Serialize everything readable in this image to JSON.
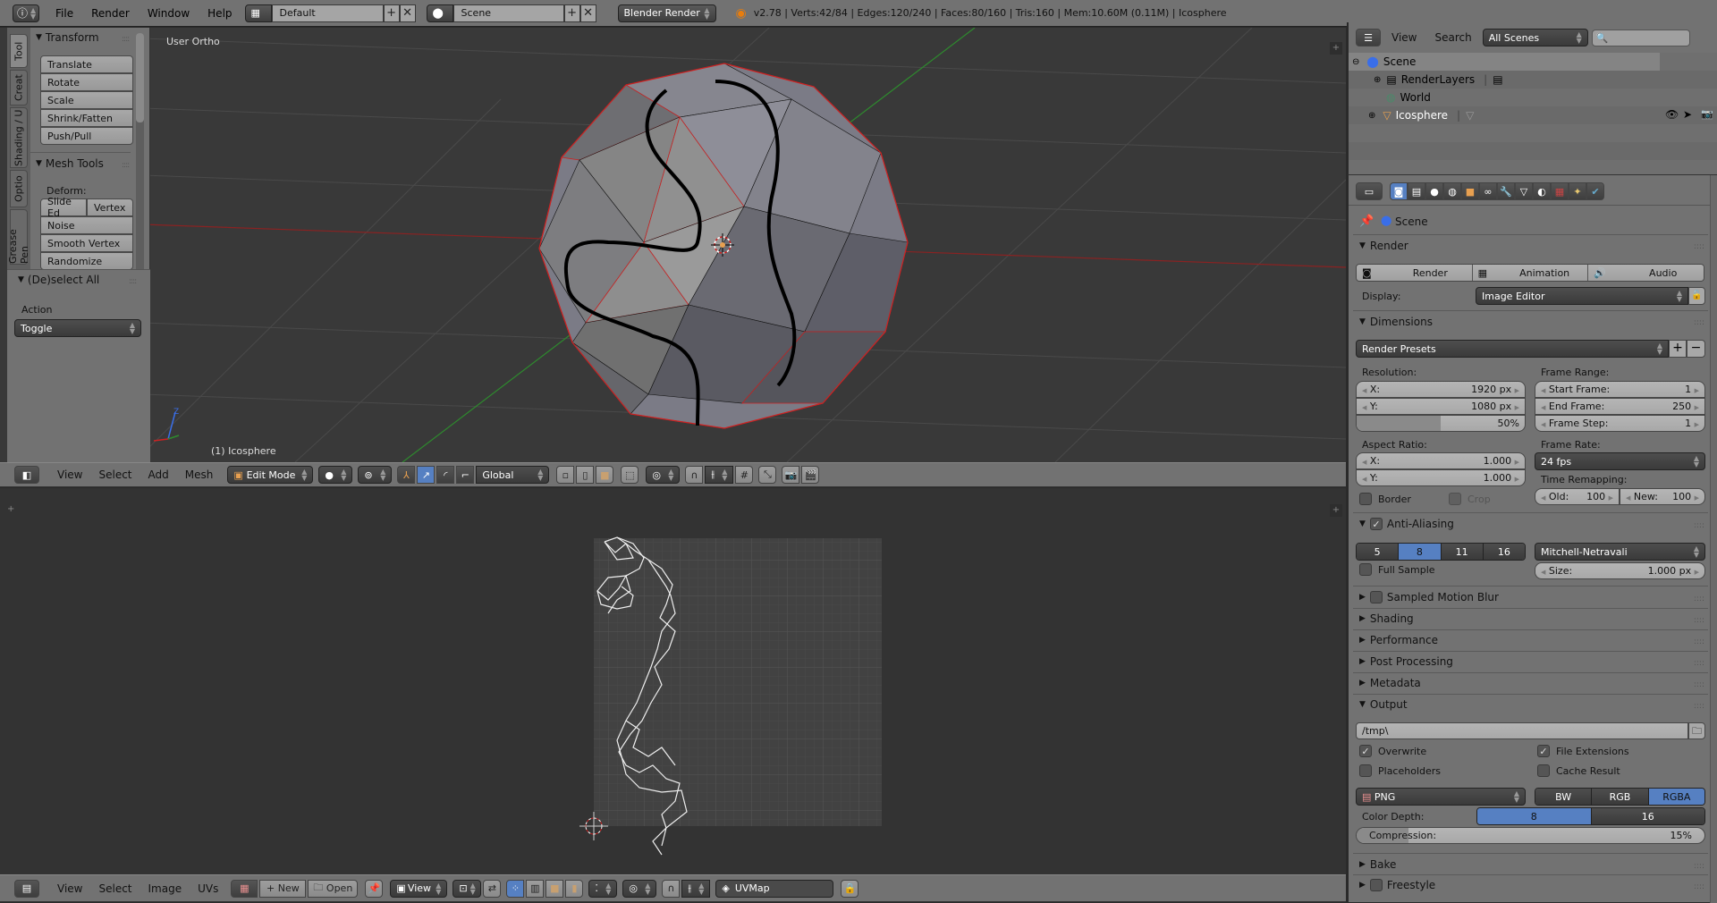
{
  "topbar": {
    "menus": [
      "File",
      "Render",
      "Window",
      "Help"
    ],
    "layout": "Default",
    "scene": "Scene",
    "engine": "Blender Render",
    "stats": "v2.78 | Verts:42/84 | Edges:120/240 | Faces:80/160 | Tris:160 | Mem:10.60M (0.11M) | Icosphere"
  },
  "toolshelf": {
    "tabs": [
      "Tool",
      "Creat",
      "Shading / U",
      "Optio",
      "Grease Pen"
    ],
    "transform_title": "Transform",
    "transform_buttons": [
      "Translate",
      "Rotate",
      "Scale",
      "Shrink/Fatten",
      "Push/Pull"
    ],
    "mesh_tools_title": "Mesh Tools",
    "deform_label": "Deform:",
    "deform_row": [
      "Slide Ed",
      "Vertex"
    ],
    "deform_buttons": [
      "Noise",
      "Smooth Vertex",
      "Randomize"
    ],
    "operator_title": "(De)select All",
    "action_label": "Action",
    "action_value": "Toggle"
  },
  "viewport": {
    "view_label": "User Ortho",
    "object_label": "(1) Icosphere",
    "axis_z": "Z"
  },
  "view3d_header": {
    "menus": [
      "View",
      "Select",
      "Add",
      "Mesh"
    ],
    "mode": "Edit Mode",
    "orientation": "Global"
  },
  "uv_header": {
    "menus": [
      "View",
      "Select",
      "Image",
      "UVs"
    ],
    "new_label": "New",
    "open_label": "Open",
    "view_label": "View",
    "uvmap": "UVMap"
  },
  "outliner": {
    "menus": [
      "View",
      "Search"
    ],
    "filter": "All Scenes",
    "search_placeholder": "",
    "items": [
      {
        "label": "Scene"
      },
      {
        "label": "RenderLayers"
      },
      {
        "label": "World"
      },
      {
        "label": "Icosphere"
      }
    ]
  },
  "properties": {
    "context": "Scene",
    "render": {
      "title": "Render",
      "buttons": [
        "Render",
        "Animation",
        "Audio"
      ],
      "display_label": "Display:",
      "display_value": "Image Editor"
    },
    "dimensions": {
      "title": "Dimensions",
      "presets": "Render Presets",
      "resolution_label": "Resolution:",
      "res_x_label": "X:",
      "res_x": "1920 px",
      "res_y_label": "Y:",
      "res_y": "1080 px",
      "res_pct": "50%",
      "res_pct_value": 0.5,
      "frame_range_label": "Frame Range:",
      "start_label": "Start Frame:",
      "start": "1",
      "end_label": "End Frame:",
      "end": "250",
      "step_label": "Frame Step:",
      "step": "1",
      "aspect_label": "Aspect Ratio:",
      "asp_x_label": "X:",
      "asp_x": "1.000",
      "asp_y_label": "Y:",
      "asp_y": "1.000",
      "frame_rate_label": "Frame Rate:",
      "frame_rate": "24 fps",
      "remap_label": "Time Remapping:",
      "old_label": "Old:",
      "old": "100",
      "new_label": "New:",
      "new": "100",
      "border_label": "Border",
      "crop_label": "Crop"
    },
    "aa": {
      "title": "Anti-Aliasing",
      "enabled": true,
      "samples": [
        "5",
        "8",
        "11",
        "16"
      ],
      "selected": "8",
      "filter": "Mitchell-Netravali",
      "full_sample_label": "Full Sample",
      "size_label": "Size:",
      "size": "1.000 px"
    },
    "collapsed_panels": [
      "Sampled Motion Blur",
      "Shading",
      "Performance",
      "Post Processing",
      "Metadata"
    ],
    "output": {
      "title": "Output",
      "path": "/tmp\\",
      "overwrite_label": "Overwrite",
      "overwrite": true,
      "file_ext_label": "File Extensions",
      "file_ext": true,
      "placeholders_label": "Placeholders",
      "placeholders": false,
      "cache_label": "Cache Result",
      "cache": false,
      "format": "PNG",
      "color_modes": [
        "BW",
        "RGB",
        "RGBA"
      ],
      "color_mode": "RGBA",
      "depth_label": "Color Depth:",
      "depths": [
        "8",
        "16"
      ],
      "depth": "8",
      "compression_label": "Compression:",
      "compression": "15%",
      "compression_value": 0.15
    },
    "bottom_panels": [
      "Bake",
      "Freestyle"
    ]
  },
  "colors": {
    "accent": "#5680c2",
    "seam": "#cc2222",
    "grease_pencil": "#000000"
  }
}
